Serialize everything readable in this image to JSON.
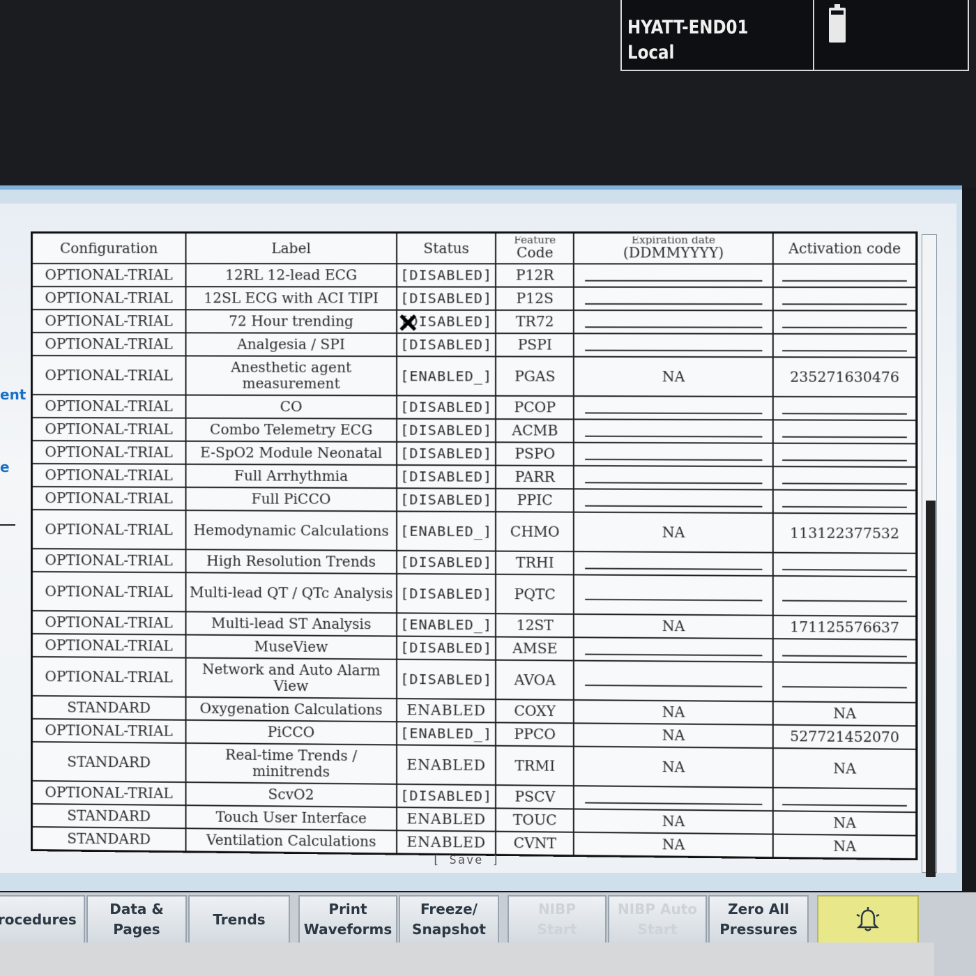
{
  "header": {
    "unit_name": "HYATT-END01",
    "unit_location": "Local"
  },
  "left_partial": {
    "text1": "ent",
    "text2": "e"
  },
  "table": {
    "columns": [
      "Configuration",
      "Label",
      "Status",
      "Feature Code",
      "Expiration date (DDMMYYYY)",
      "Activation code"
    ],
    "header": {
      "configuration": "Configuration",
      "label": "Label",
      "status": "Status",
      "code_top": "Feature",
      "code": "Code",
      "exp_top": "Expiration date",
      "exp": "(DDMMYYYY)",
      "activation": "Activation code"
    },
    "rows": [
      {
        "config": "OPTIONAL-TRIAL",
        "label": "12RL 12-lead ECG",
        "status": "[DISABLED]",
        "code": "P12R",
        "exp": "",
        "act": ""
      },
      {
        "config": "OPTIONAL-TRIAL",
        "label": "12SL ECG with ACI TIPI",
        "status": "[DISABLED]",
        "code": "P12S",
        "exp": "",
        "act": ""
      },
      {
        "config": "OPTIONAL-TRIAL",
        "label": "72 Hour trending",
        "status": "[DISABLED]",
        "code": "TR72",
        "exp": "",
        "act": ""
      },
      {
        "config": "OPTIONAL-TRIAL",
        "label": "Analgesia / SPI",
        "status": "[DISABLED]",
        "code": "PSPI",
        "exp": "",
        "act": ""
      },
      {
        "config": "OPTIONAL-TRIAL",
        "label": "Anesthetic agent measurement",
        "status": "[ENABLED_]",
        "code": "PGAS",
        "exp": "NA",
        "act": "235271630476"
      },
      {
        "config": "OPTIONAL-TRIAL",
        "label": "CO",
        "status": "[DISABLED]",
        "code": "PCOP",
        "exp": "",
        "act": ""
      },
      {
        "config": "OPTIONAL-TRIAL",
        "label": "Combo Telemetry ECG",
        "status": "[DISABLED]",
        "code": "ACMB",
        "exp": "",
        "act": ""
      },
      {
        "config": "OPTIONAL-TRIAL",
        "label": "E-SpO2 Module Neonatal",
        "status": "[DISABLED]",
        "code": "PSPO",
        "exp": "",
        "act": ""
      },
      {
        "config": "OPTIONAL-TRIAL",
        "label": "Full Arrhythmia",
        "status": "[DISABLED]",
        "code": "PARR",
        "exp": "",
        "act": ""
      },
      {
        "config": "OPTIONAL-TRIAL",
        "label": "Full PiCCO",
        "status": "[DISABLED]",
        "code": "PPIC",
        "exp": "",
        "act": ""
      },
      {
        "config": "OPTIONAL-TRIAL",
        "label": "Hemodynamic Calculations",
        "status": "[ENABLED_]",
        "code": "CHMO",
        "exp": "NA",
        "act": "113122377532"
      },
      {
        "config": "OPTIONAL-TRIAL",
        "label": "High Resolution Trends",
        "status": "[DISABLED]",
        "code": "TRHI",
        "exp": "",
        "act": ""
      },
      {
        "config": "OPTIONAL-TRIAL",
        "label": "Multi-lead QT / QTc Analysis",
        "status": "[DISABLED]",
        "code": "PQTC",
        "exp": "",
        "act": ""
      },
      {
        "config": "OPTIONAL-TRIAL",
        "label": "Multi-lead ST Analysis",
        "status": "[ENABLED_]",
        "code": "12ST",
        "exp": "NA",
        "act": "171125576637"
      },
      {
        "config": "OPTIONAL-TRIAL",
        "label": "MuseView",
        "status": "[DISABLED]",
        "code": "AMSE",
        "exp": "",
        "act": ""
      },
      {
        "config": "OPTIONAL-TRIAL",
        "label": "Network and Auto Alarm View",
        "status": "[DISABLED]",
        "code": "AVOA",
        "exp": "",
        "act": ""
      },
      {
        "config": "STANDARD",
        "label": "Oxygenation Calculations",
        "status": "ENABLED",
        "code": "COXY",
        "exp": "NA",
        "act": "NA"
      },
      {
        "config": "OPTIONAL-TRIAL",
        "label": "PiCCO",
        "status": "[ENABLED_]",
        "code": "PPCO",
        "exp": "NA",
        "act": "527721452070"
      },
      {
        "config": "STANDARD",
        "label": "Real-time Trends / minitrends",
        "status": "ENABLED",
        "code": "TRMI",
        "exp": "NA",
        "act": "NA"
      },
      {
        "config": "OPTIONAL-TRIAL",
        "label": "ScvO2",
        "status": "[DISABLED]",
        "code": "PSCV",
        "exp": "",
        "act": ""
      },
      {
        "config": "STANDARD",
        "label": "Touch User Interface",
        "status": "ENABLED",
        "code": "TOUC",
        "exp": "NA",
        "act": "NA"
      },
      {
        "config": "STANDARD",
        "label": "Ventilation Calculations",
        "status": "ENABLED",
        "code": "CVNT",
        "exp": "NA",
        "act": "NA"
      }
    ]
  },
  "save_label": "[ Save ]",
  "softkeys": [
    {
      "label": "Procedures",
      "dim": false
    },
    {
      "label": "Data &\nPages",
      "dim": false
    },
    {
      "label": "Trends",
      "dim": false
    },
    {
      "label": "Print\nWaveforms",
      "dim": false
    },
    {
      "label": "Freeze/\nSnapshot",
      "dim": false
    },
    {
      "label": "NIBP\nStart",
      "dim": true
    },
    {
      "label": "NIBP Auto\nStart",
      "dim": true
    },
    {
      "label": "Zero All\nPressures",
      "dim": false
    }
  ],
  "icons": {
    "battery": "battery-icon",
    "alarm": "alarm-bell-icon",
    "cursor": "x-cursor-icon"
  },
  "colors": {
    "accent": "#7fb2da",
    "alarm_button": "#e8e88a",
    "left_link": "#1870c8"
  }
}
